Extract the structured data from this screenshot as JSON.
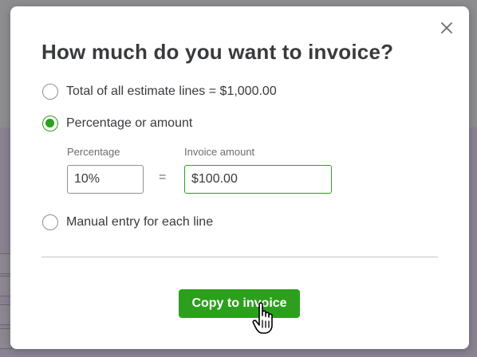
{
  "dialog": {
    "title": "How much do you want to invoice?",
    "close_icon": "close-icon",
    "options": [
      {
        "label": "Total of all estimate lines = $1,000.00",
        "checked": false
      },
      {
        "label": "Percentage or amount",
        "checked": true
      },
      {
        "label": "Manual entry for each line",
        "checked": false
      }
    ],
    "percentage": {
      "label": "Percentage",
      "value": "10%"
    },
    "equals": "=",
    "invoice_amount": {
      "label": "Invoice amount",
      "value": "$100.00"
    },
    "primary_button": "Copy to invoice",
    "cursor_icon": "hand-pointer-icon"
  },
  "colors": {
    "accent": "#2ca01c",
    "text": "#393a3d",
    "muted_text": "#6b6c72",
    "overlay": "#8d8d8f"
  }
}
